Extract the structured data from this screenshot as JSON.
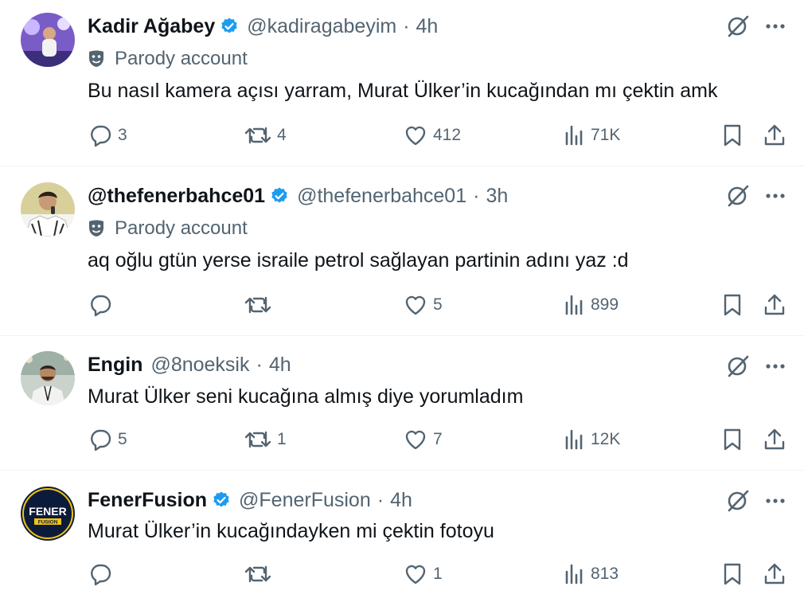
{
  "tweets": [
    {
      "name": "Kadir Ağabey",
      "verified": true,
      "handle": "@kadiragabeyim",
      "separator": "·",
      "time": "4h",
      "parody_label": "Parody account",
      "text": "Bu nasıl kamera açısı yarram, Murat Ülker’in kucağından mı çektin amk",
      "replies": "3",
      "retweets": "4",
      "likes": "412",
      "views": "71K"
    },
    {
      "name": "@thefenerbahce01",
      "verified": true,
      "handle": "@thefenerbahce01",
      "separator": "·",
      "time": "3h",
      "parody_label": "Parody account",
      "text": "aq oğlu gtün yerse israile petrol sağlayan partinin adını yaz :d",
      "replies": "",
      "retweets": "",
      "likes": "5",
      "views": "899"
    },
    {
      "name": "Engin",
      "verified": false,
      "handle": "@8noeksik",
      "separator": "·",
      "time": "4h",
      "text": "Murat Ülker seni kucağına almış diye yorumladım",
      "replies": "5",
      "retweets": "1",
      "likes": "7",
      "views": "12K"
    },
    {
      "name": "FenerFusion",
      "verified": true,
      "handle": "@FenerFusion",
      "separator": "·",
      "time": "4h",
      "avatar_logo_text": "FENER FUSION",
      "text": "Murat Ülker’in kucağındayken mi çektin fotoyu",
      "replies": "",
      "retweets": "",
      "likes": "1",
      "views": "813"
    }
  ],
  "icons": {
    "verified": "verified-badge-icon",
    "parody": "parody-mask-icon",
    "grok": "grok-icon",
    "more": "more-icon",
    "reply": "reply-icon",
    "retweet": "retweet-icon",
    "like": "like-icon",
    "views": "views-icon",
    "bookmark": "bookmark-icon",
    "share": "share-icon"
  },
  "colors": {
    "text": "#0f1419",
    "secondary": "#536471",
    "verified": "#1d9bf0",
    "divider": "#eff3f4"
  }
}
